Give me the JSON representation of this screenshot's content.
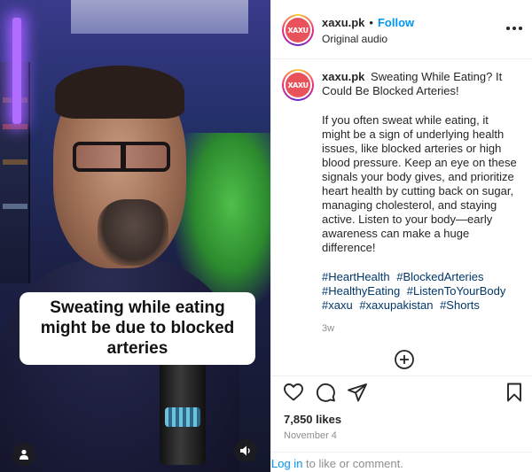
{
  "video": {
    "caption": "Sweating while eating might be due to blocked arteries",
    "user_tag_icon": "person-icon",
    "audio_icon": "speaker-icon"
  },
  "header": {
    "avatar_text": "XAXU",
    "username": "xaxu.pk",
    "separator": "•",
    "follow_label": "Follow",
    "audio_label": "Original audio",
    "more_icon": "more-options-icon"
  },
  "post": {
    "username": "xaxu.pk",
    "title": "Sweating While Eating? It Could Be Blocked Arteries!",
    "text": "If you often sweat while eating, it might be a sign of underlying health issues, like blocked arteries or high blood pressure. Keep an eye on these signals your body gives, and prioritize heart health by cutting back on sugar, managing cholesterol, and staying active. Listen to your body—early awareness can make a huge difference!",
    "hashtags": [
      "#HeartHealth",
      "#BlockedArteries",
      "#HealthyEating",
      "#ListenToYourBody",
      "#xaxu",
      "#xaxupakistan",
      "#Shorts"
    ],
    "age": "3w"
  },
  "actions": {
    "like_icon": "heart-icon",
    "comment_icon": "comment-icon",
    "share_icon": "send-icon",
    "save_icon": "bookmark-icon",
    "likes": "7,850 likes",
    "date": "November 4"
  },
  "footer": {
    "login_link": "Log in",
    "login_rest": "to like or comment."
  },
  "colors": {
    "link": "#0095f6",
    "hashtag": "#00376b",
    "muted": "#8e8e8e",
    "text": "#262626",
    "brand_avatar": "#e8525a"
  }
}
